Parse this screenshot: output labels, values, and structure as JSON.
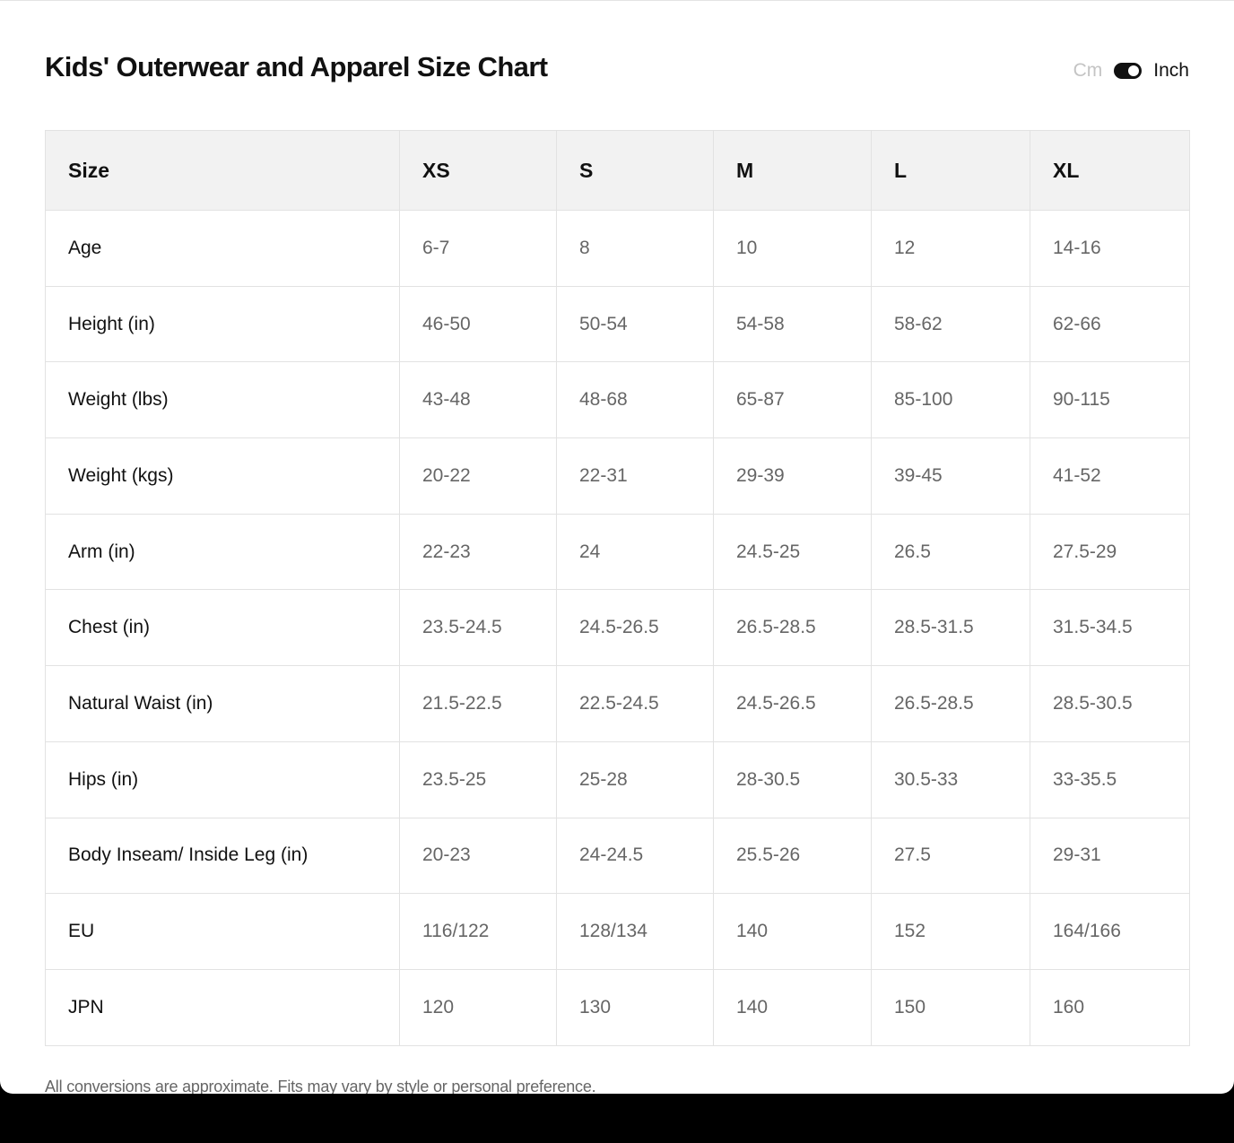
{
  "title": "Kids' Outerwear and Apparel Size Chart",
  "unit_toggle": {
    "cm_label": "Cm",
    "inch_label": "Inch",
    "selected": "Inch"
  },
  "table": {
    "headers": [
      "Size",
      "XS",
      "S",
      "M",
      "L",
      "XL"
    ],
    "rows": [
      [
        "Age",
        "6-7",
        "8",
        "10",
        "12",
        "14-16"
      ],
      [
        "Height (in)",
        "46-50",
        "50-54",
        "54-58",
        "58-62",
        "62-66"
      ],
      [
        "Weight (lbs)",
        "43-48",
        "48-68",
        "65-87",
        "85-100",
        "90-115"
      ],
      [
        "Weight (kgs)",
        "20-22",
        "22-31",
        "29-39",
        "39-45",
        "41-52"
      ],
      [
        "Arm (in)",
        "22-23",
        "24",
        "24.5-25",
        "26.5",
        "27.5-29"
      ],
      [
        "Chest (in)",
        "23.5-24.5",
        "24.5-26.5",
        "26.5-28.5",
        "28.5-31.5",
        "31.5-34.5"
      ],
      [
        "Natural Waist (in)",
        "21.5-22.5",
        "22.5-24.5",
        "24.5-26.5",
        "26.5-28.5",
        "28.5-30.5"
      ],
      [
        "Hips (in)",
        "23.5-25",
        "25-28",
        "28-30.5",
        "30.5-33",
        "33-35.5"
      ],
      [
        "Body Inseam/ Inside Leg (in)",
        "20-23",
        "24-24.5",
        "25.5-26",
        "27.5",
        "29-31"
      ],
      [
        "EU",
        "116/122",
        "128/134",
        "140",
        "152",
        "164/166"
      ],
      [
        "JPN",
        "120",
        "130",
        "140",
        "150",
        "160"
      ]
    ]
  },
  "footnote": "All conversions are approximate. Fits may vary by style or personal preference."
}
